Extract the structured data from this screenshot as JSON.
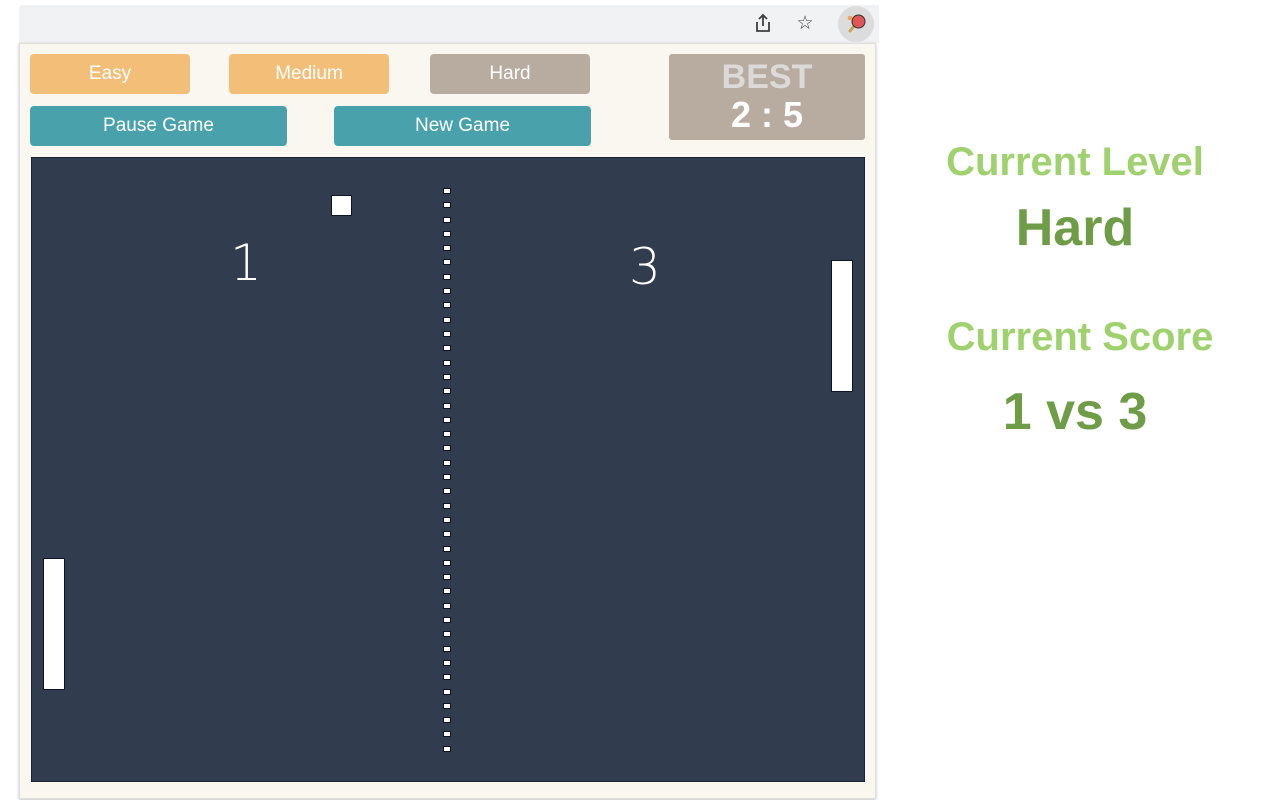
{
  "browser": {
    "icons": [
      "share-icon",
      "bookmark-star-icon",
      "ping-pong-extension-icon"
    ],
    "share_glyph": "⇪",
    "star_glyph": "☆"
  },
  "controls": {
    "levels": [
      {
        "label": "Easy",
        "color": "#f2be78",
        "selected": false
      },
      {
        "label": "Medium",
        "color": "#f2be78",
        "selected": false
      },
      {
        "label": "Hard",
        "color": "#b8aca1",
        "selected": true
      }
    ],
    "pause_label": "Pause Game",
    "new_game_label": "New Game",
    "action_color": "#48a1ab"
  },
  "best": {
    "label": "BEST",
    "score": "2 : 5"
  },
  "game": {
    "left_score": "1",
    "right_score": "3",
    "court_color": "#313d4e"
  },
  "info": {
    "level_label": "Current Level",
    "level_value": "Hard",
    "score_label": "Current Score",
    "score_value": "1 vs 3",
    "label_color": "#9fd26e",
    "value_color": "#6e9c47"
  }
}
